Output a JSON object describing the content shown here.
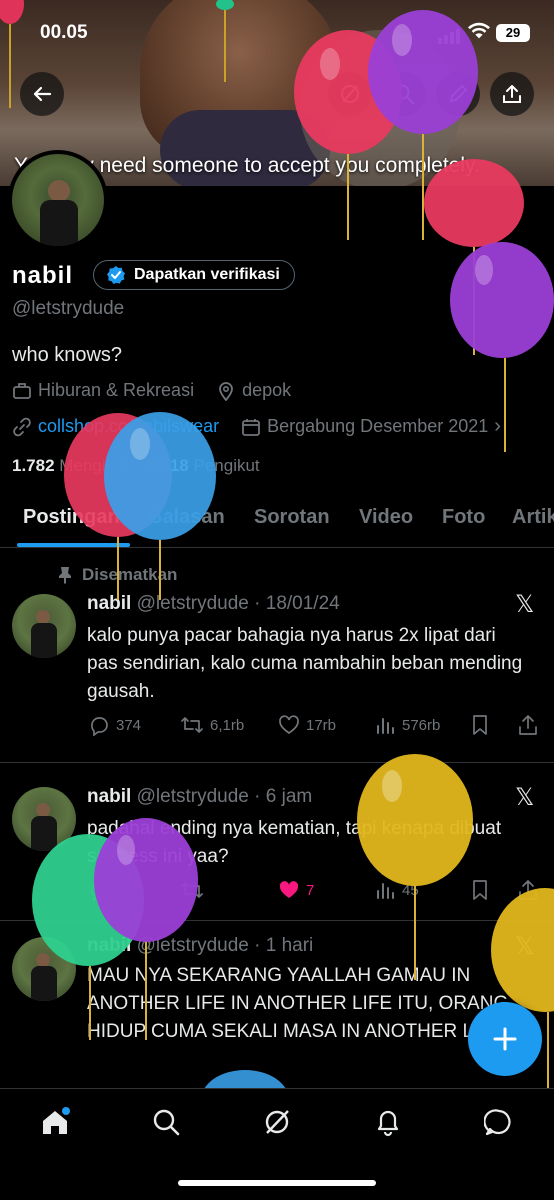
{
  "status_bar": {
    "time": "00.05",
    "battery": "29"
  },
  "banner": {
    "caption": "You only need someone to accept you completely."
  },
  "profile": {
    "name": "nabil",
    "verify_label": "Dapatkan verifikasi",
    "handle": "@letstrydude",
    "bio": "who knows?",
    "category": "Hiburan & Rekreasi",
    "location": "depok",
    "link": "collshop.co/nabilswear",
    "joined": "Bergabung Desember 2021",
    "following_count": "1.782",
    "following_label": "Mengikuti",
    "followers_count": "8.318",
    "followers_label": "Pengikut"
  },
  "tabs": [
    {
      "label": "Postingan"
    },
    {
      "label": "Balasan"
    },
    {
      "label": "Sorotan"
    },
    {
      "label": "Video"
    },
    {
      "label": "Foto"
    },
    {
      "label": "Artikel"
    }
  ],
  "pinned_label": "Disematkan",
  "posts": [
    {
      "name": "nabil",
      "handle": "@letstrydude",
      "time": "· 18/01/24",
      "text": "kalo punya pacar bahagia nya harus 2x lipat dari pas sendirian, kalo cuma nambahin beban mending gausah.",
      "replies": "374",
      "reposts": "6,1rb",
      "likes": "17rb",
      "views": "576rb"
    },
    {
      "name": "nabil",
      "handle": "@letstrydude",
      "time": "· 6 jam",
      "text": "padahal ending nya kematian, tapi kenapa dibuat sestress ini yaa?",
      "replies": "",
      "reposts": "",
      "likes": "7",
      "views": "45"
    },
    {
      "name": "nabil",
      "handle": "@letstrydude",
      "time": "· 1 hari",
      "text": "MAU NYA SEKARANG YAALLAH GAMAU IN ANOTHER LIFE IN ANOTHER LIFE ITU, ORANG HIDUP CUMA SEKALI MASA IN ANOTHER LIFE :("
    }
  ],
  "colors": {
    "accent": "#1d9bf0",
    "like": "#f91880",
    "muted": "#71767b",
    "border": "#2f3336"
  },
  "icons": [
    "back-icon",
    "grok-icon",
    "search-icon",
    "edit-icon",
    "share-icon",
    "verified-icon",
    "category-icon",
    "location-icon",
    "link-icon",
    "calendar-icon",
    "pin-icon",
    "x-logo-icon",
    "reply-icon",
    "repost-icon",
    "like-icon",
    "views-icon",
    "bookmark-icon",
    "plus-icon",
    "home-icon",
    "notifications-icon",
    "messages-icon",
    "balloon-icon"
  ]
}
